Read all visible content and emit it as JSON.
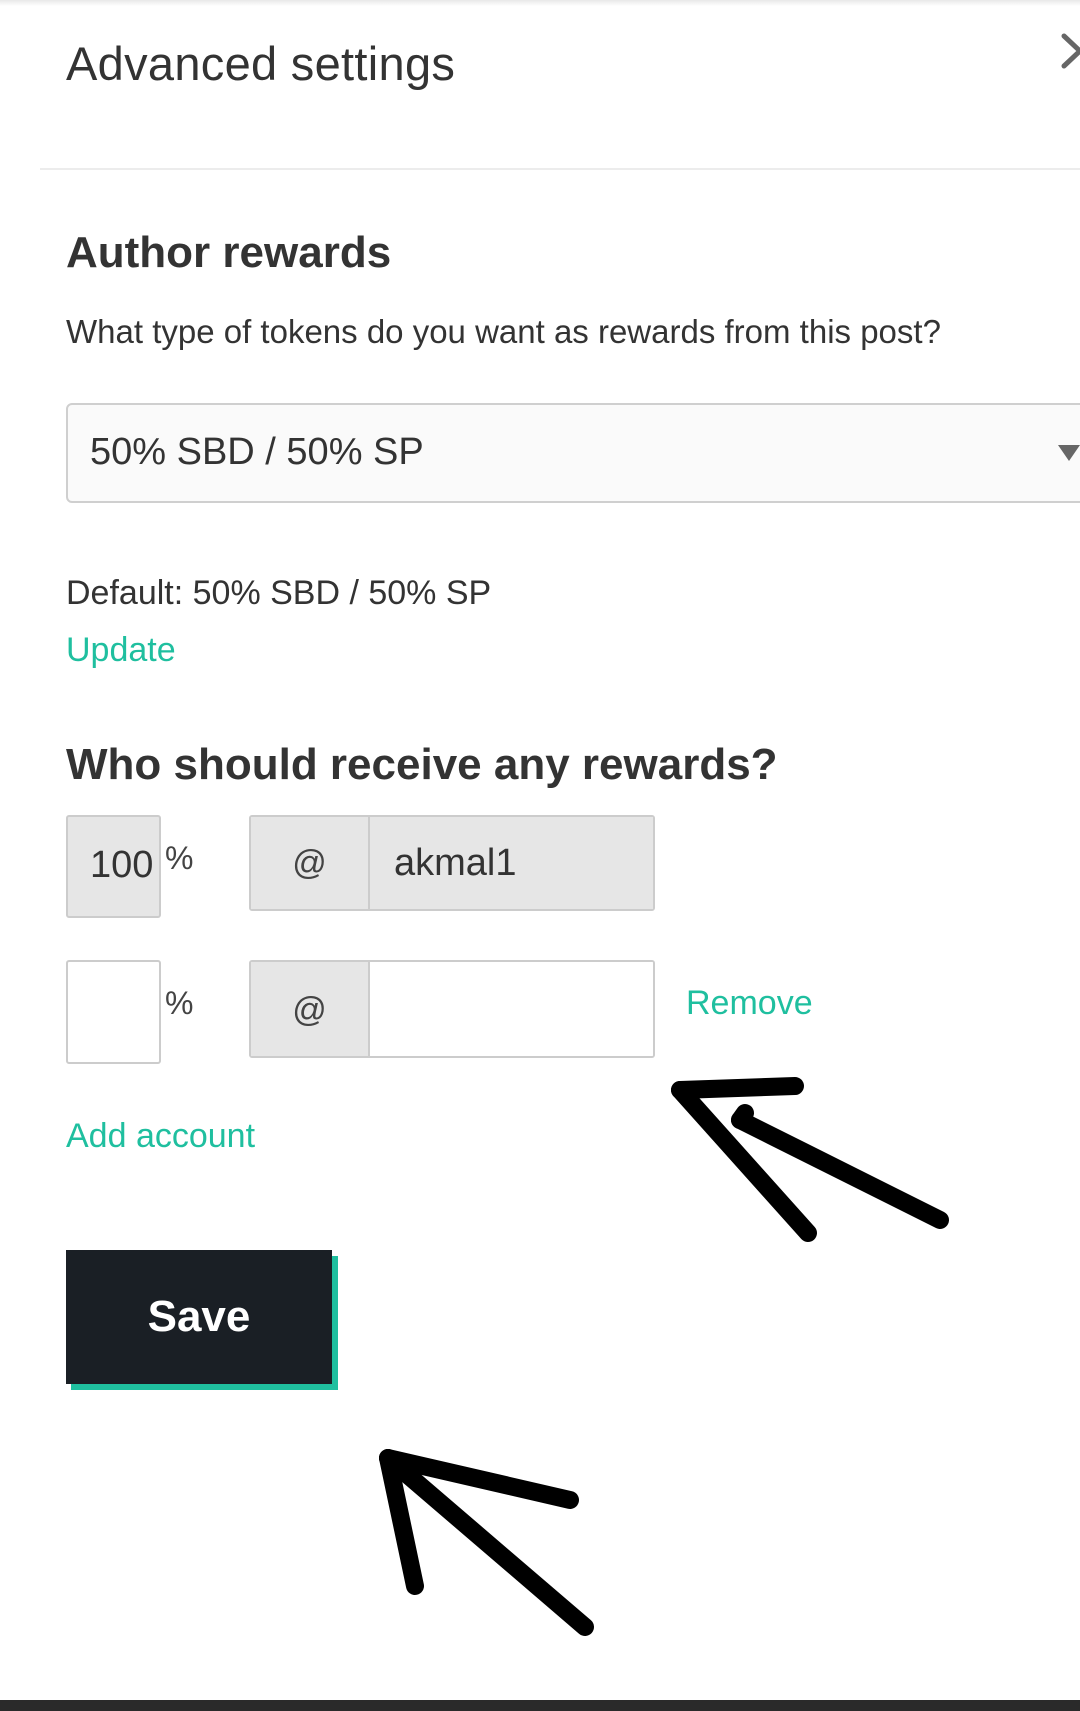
{
  "modal": {
    "title": "Advanced settings"
  },
  "author_rewards": {
    "heading": "Author rewards",
    "prompt": "What type of tokens do you want as rewards from this post?",
    "selected_option": "50% SBD / 50% SP",
    "default_text": "Default: 50% SBD / 50% SP",
    "update_label": "Update"
  },
  "beneficiaries": {
    "heading": "Who should receive any rewards?",
    "rows": [
      {
        "percent": "100",
        "percent_sign": "%",
        "at_symbol": "@",
        "account": "akmal1"
      },
      {
        "percent": "",
        "percent_sign": "%",
        "at_symbol": "@",
        "account": "",
        "remove_label": "Remove"
      }
    ],
    "add_account_label": "Add account"
  },
  "actions": {
    "save_label": "Save"
  },
  "colors": {
    "accent": "#1fbf9f",
    "button_bg": "#1a1f25",
    "input_disabled_bg": "#e6e6e6",
    "annotation_arrow": "#000000"
  },
  "icons": {
    "close": "close-icon",
    "dropdown": "chevron-down-icon"
  }
}
